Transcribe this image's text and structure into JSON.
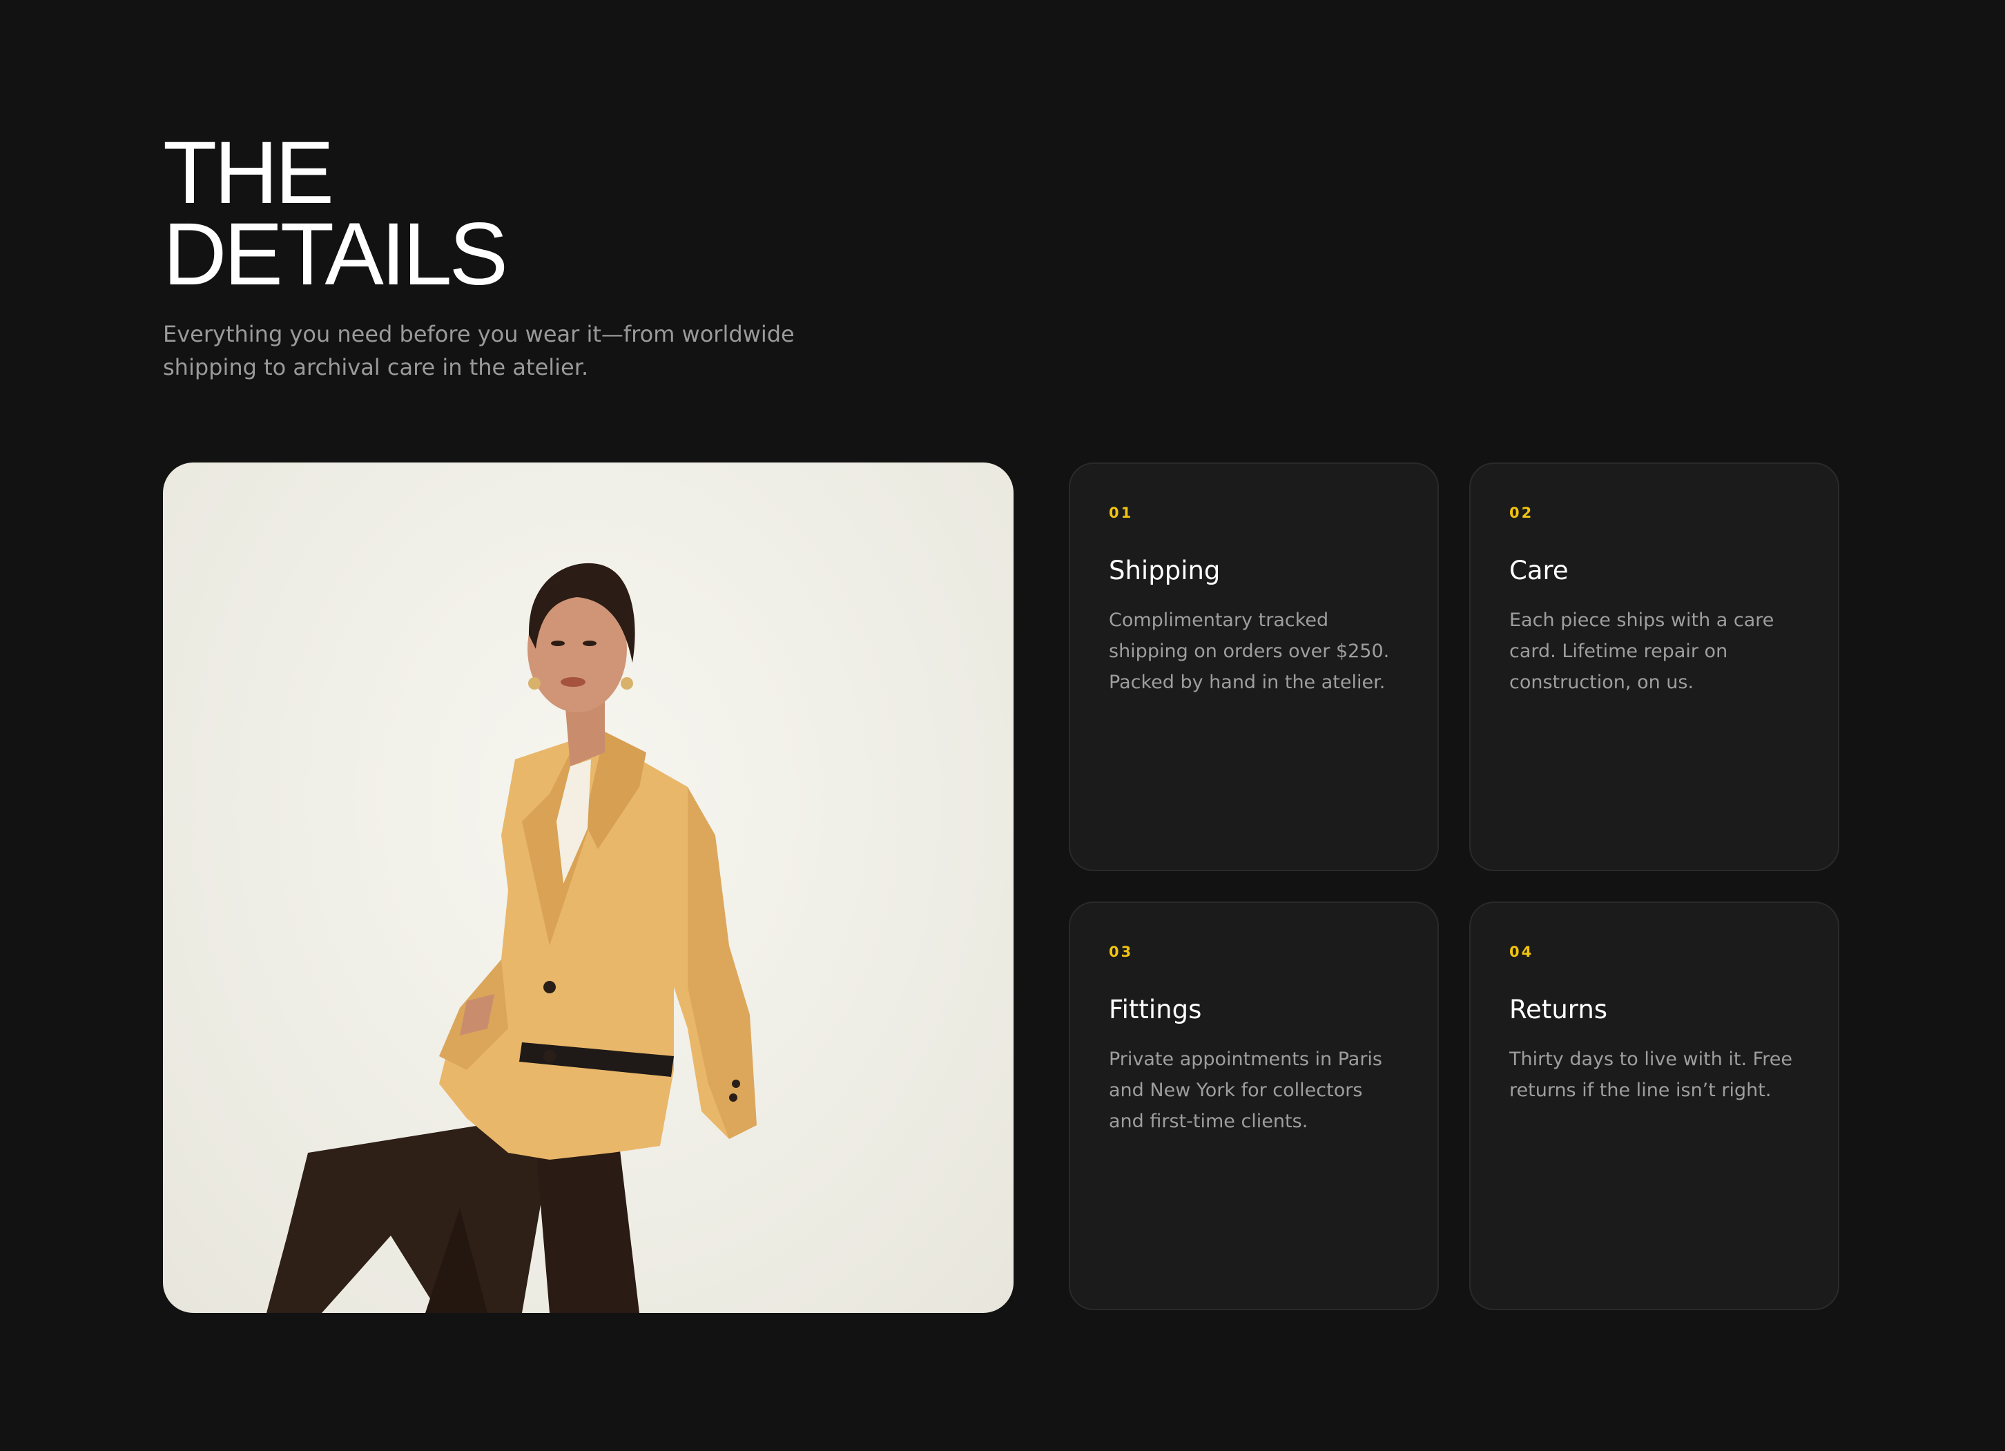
{
  "header": {
    "title_line1": "THE",
    "title_line2": "DETAILS",
    "subtitle": "Everything you need before you wear it—from worldwide shipping to archival care in the atelier."
  },
  "hero": {
    "image_subject": "model-in-mustard-blazer"
  },
  "cards": [
    {
      "number": "01",
      "title": "Shipping",
      "text": "Complimentary tracked shipping on orders over $250. Packed by hand in the atelier."
    },
    {
      "number": "02",
      "title": "Care",
      "text": "Each piece ships with a care card. Lifetime repair on construction, on us."
    },
    {
      "number": "03",
      "title": "Fittings",
      "text": "Private appointments in Paris and New York for collectors and first-time clients."
    },
    {
      "number": "04",
      "title": "Returns",
      "text": "Thirty days to live with it. Free returns if the line isn’t right."
    }
  ],
  "colors": {
    "background": "#121212",
    "card": "#1b1b1b",
    "accent": "#f1c40f",
    "muted_text": "#9e9e9e"
  }
}
